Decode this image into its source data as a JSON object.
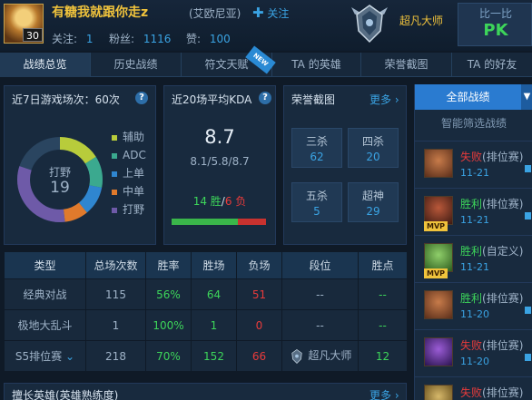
{
  "header": {
    "player_name": "有糖我就跟你走z",
    "level": "30",
    "server": "(艾欧尼亚)",
    "follow_label": "关注",
    "follows_label": "关注:",
    "follows_count": "1",
    "fans_label": "粉丝:",
    "fans_count": "1116",
    "likes_label": "赞:",
    "likes_count": "100",
    "rank_name": "超凡大师",
    "pk_title": "比一比",
    "pk_label": "PK"
  },
  "tabs": [
    {
      "label": "战绩总览",
      "active": true
    },
    {
      "label": "历史战绩"
    },
    {
      "label": "符文天赋",
      "badge": "NEW"
    },
    {
      "label": "TA 的英雄"
    },
    {
      "label": "荣誉截图"
    },
    {
      "label": "TA 的好友"
    }
  ],
  "recent_games": {
    "title": "近7日游戏场次：60次",
    "center_label": "打野",
    "center_value": "19",
    "legend": [
      {
        "label": "辅助",
        "color": "#b8cc3b"
      },
      {
        "label": "ADC",
        "color": "#3ba98f"
      },
      {
        "label": "上单",
        "color": "#2f86d0"
      },
      {
        "label": "中单",
        "color": "#e07a2c"
      },
      {
        "label": "打野",
        "color": "#6e5aa8"
      }
    ],
    "ring_share": {
      "辅助": 0.16,
      "ADC": 0.12,
      "上单": 0.11,
      "中单": 0.09,
      "打野": 0.32
    }
  },
  "kda": {
    "title": "近20场平均KDA",
    "value": "8.7",
    "detail": "8.1/5.8/8.7",
    "wins": "14 胜",
    "separator": "/",
    "losses": "6 负",
    "win_fraction": 0.7
  },
  "honor": {
    "title": "荣誉截图",
    "more": "更多",
    "items": [
      {
        "label": "三杀",
        "value": "62"
      },
      {
        "label": "四杀",
        "value": "20"
      },
      {
        "label": "五杀",
        "value": "5"
      },
      {
        "label": "超神",
        "value": "29"
      }
    ]
  },
  "table": {
    "headers": [
      "类型",
      "总场次数",
      "胜率",
      "胜场",
      "负场",
      "段位",
      "胜点"
    ],
    "rows": [
      {
        "type": "经典对战",
        "total": "115",
        "rate": "56%",
        "wins": "64",
        "losses": "51",
        "rank": "--",
        "points": "--"
      },
      {
        "type": "极地大乱斗",
        "total": "1",
        "rate": "100%",
        "wins": "1",
        "losses": "0",
        "rank": "--",
        "points": "--"
      },
      {
        "type": "S5排位赛",
        "total": "218",
        "rate": "70%",
        "wins": "152",
        "losses": "66",
        "rank": "超凡大师",
        "points": "12"
      }
    ]
  },
  "bottom_panel": {
    "title": "擅长英雄(英雄熟练度)",
    "more": "更多"
  },
  "sidebar": {
    "all_matches": "全部战绩",
    "smart_filter": "智能筛选战绩",
    "matches": [
      {
        "result": "失败",
        "mode": "(排位赛)",
        "date": "11-21",
        "mvp": false,
        "color": "#e83b3b"
      },
      {
        "result": "胜利",
        "mode": "(排位赛)",
        "date": "11-21",
        "mvp": true,
        "color": "#3dd55a"
      },
      {
        "result": "胜利",
        "mode": "(自定义)",
        "date": "11-21",
        "mvp": true,
        "color": "#3dd55a"
      },
      {
        "result": "胜利",
        "mode": "(排位赛)",
        "date": "11-20",
        "mvp": false,
        "color": "#3dd55a"
      },
      {
        "result": "失败",
        "mode": "(排位赛)",
        "date": "11-20",
        "mvp": false,
        "color": "#e83b3b"
      },
      {
        "result": "失败",
        "mode": "(排位赛)",
        "date": "",
        "mvp": false,
        "color": "#e83b3b"
      }
    ],
    "mvp_label": "MVP"
  }
}
